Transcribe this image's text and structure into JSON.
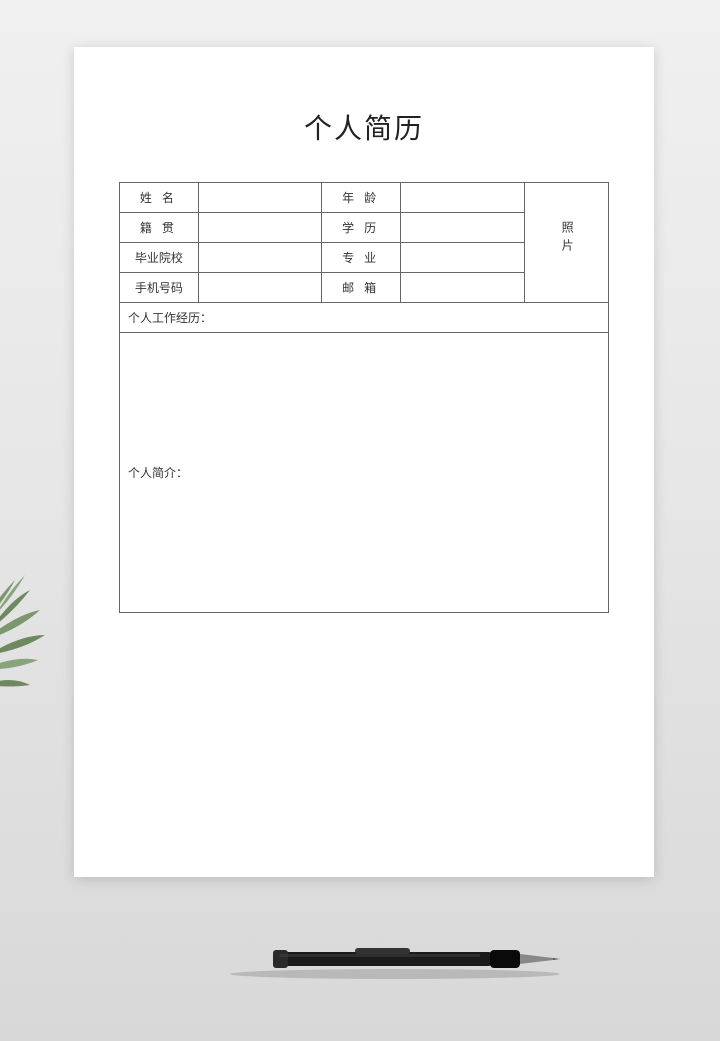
{
  "title": "个人简历",
  "fields": {
    "name_label": "姓名",
    "name_value": "",
    "age_label": "年龄",
    "age_value": "",
    "origin_label": "籍贯",
    "origin_value": "",
    "education_label": "学历",
    "education_value": "",
    "school_label": "毕业院校",
    "school_value": "",
    "major_label": "专业",
    "major_value": "",
    "phone_label": "手机号码",
    "phone_value": "",
    "email_label": "邮箱",
    "email_value": "",
    "photo_label": "照片"
  },
  "sections": {
    "work_experience_label": "个人工作经历：",
    "work_experience_value": "",
    "profile_label": "个人简介：",
    "profile_value": ""
  }
}
